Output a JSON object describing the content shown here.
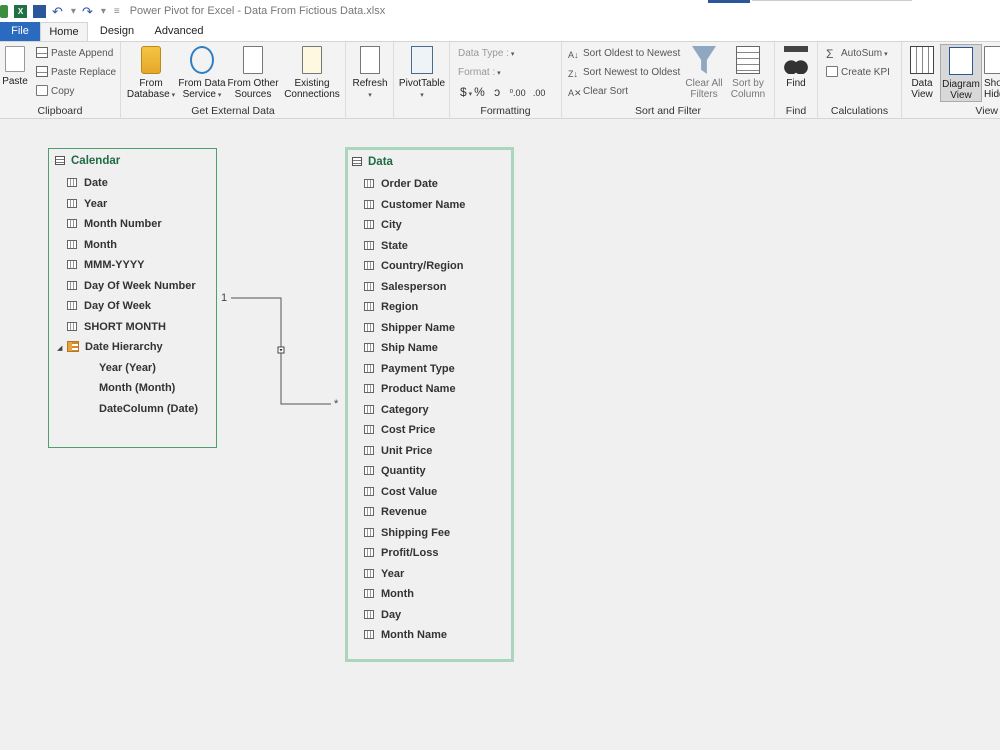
{
  "window": {
    "title": "Power Pivot for Excel - Data From Fictious Data.xlsx"
  },
  "tabs": [
    {
      "label": "File"
    },
    {
      "label": "Home"
    },
    {
      "label": "Design"
    },
    {
      "label": "Advanced"
    }
  ],
  "ribbon": {
    "clipboard": {
      "label": "Clipboard",
      "paste": "Paste",
      "paste_append": "Paste Append",
      "paste_replace": "Paste Replace",
      "copy": "Copy"
    },
    "external": {
      "label": "Get External Data",
      "from_database": [
        "From",
        "Database"
      ],
      "from_data_service": [
        "From Data",
        "Service"
      ],
      "from_other": [
        "From Other",
        "Sources"
      ],
      "existing": [
        "Existing",
        "Connections"
      ]
    },
    "refresh": "Refresh",
    "pivottable": "PivotTable",
    "formatting": {
      "label": "Formatting",
      "data_type": "Data Type :",
      "format": "Format :",
      "symbols": [
        "$",
        "%",
        "ɔ",
        "⁰.00",
        ".00"
      ]
    },
    "sort_filter": {
      "label": "Sort and Filter",
      "sort_oldest": "Sort Oldest to Newest",
      "sort_newest": "Sort Newest to Oldest",
      "clear_sort": "Clear Sort",
      "clear_filters": [
        "Clear All",
        "Filters"
      ],
      "sort_by_column": [
        "Sort by",
        "Column"
      ]
    },
    "find": {
      "label": "Find",
      "button": "Find"
    },
    "calculations": {
      "label": "Calculations",
      "autosum": "AutoSum",
      "create_kpi": "Create KPI"
    },
    "view": {
      "label": "View",
      "data_view": [
        "Data",
        "View"
      ],
      "diagram_view": [
        "Diagram",
        "View"
      ],
      "show_hidden": [
        "Sho",
        "Hidd"
      ]
    }
  },
  "diagram": {
    "calendar": {
      "title": "Calendar",
      "fields": [
        "Date",
        "Year",
        "Month Number",
        "Month",
        "MMM-YYYY",
        "Day Of Week Number",
        "Day Of Week",
        "SHORT MONTH"
      ],
      "hierarchy": {
        "name": "Date Hierarchy",
        "levels": [
          "Year (Year)",
          "Month (Month)",
          "DateColumn (Date)"
        ]
      }
    },
    "data": {
      "title": "Data",
      "fields": [
        "Order Date",
        "Customer Name",
        "City",
        "State",
        "Country/Region",
        "Salesperson",
        "Region",
        "Shipper Name",
        "Ship Name",
        "Payment Type",
        "Product Name",
        "Category",
        "Cost Price",
        "Unit Price",
        "Quantity",
        "Cost Value",
        "Revenue",
        "Shipping Fee",
        "Profit/Loss",
        "Year",
        "Month",
        "Day",
        "Month Name"
      ]
    },
    "relationship": {
      "one_label": "1",
      "many_label": "*"
    }
  },
  "colors": {
    "file_tab": "#2b6bbf",
    "table_title": "#1f6b43",
    "selected_border": "#a9d6bd",
    "table_border": "#4f9e6f"
  }
}
